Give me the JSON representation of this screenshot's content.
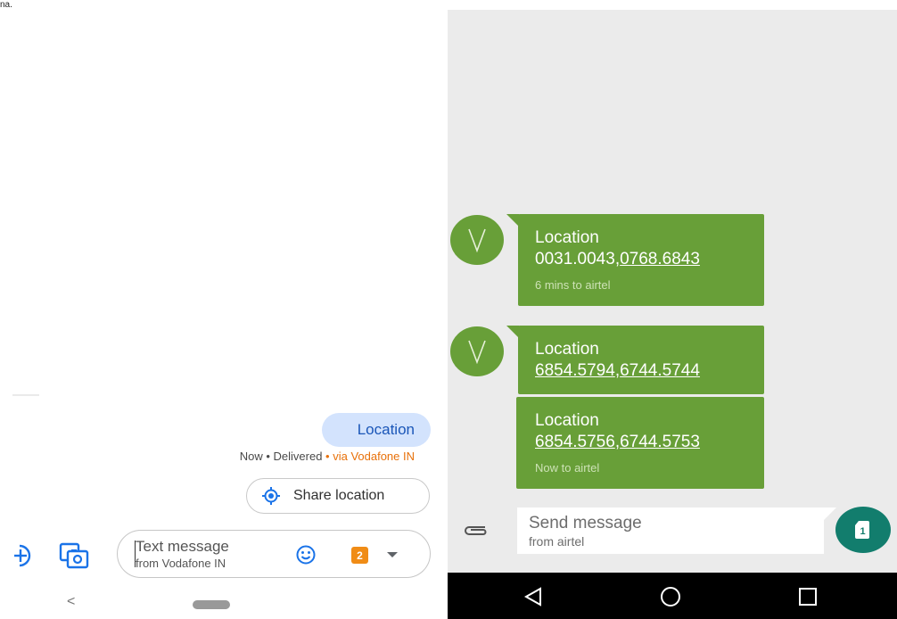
{
  "left": {
    "corner_text": "na.",
    "sent_message": "Location",
    "status": {
      "prefix": "Now • Delivered",
      "via": " • via Vodafone IN"
    },
    "share_location_label": "Share location",
    "compose": {
      "placeholder_line1": "Text message",
      "placeholder_line2": "from Vodafone IN",
      "sim_number": "2"
    },
    "nav": {
      "back_glyph": "<"
    },
    "icons": [
      "add-icon",
      "gallery-icon",
      "location-target-icon",
      "emoji-icon",
      "sim-icon",
      "dropdown-arrow-icon"
    ]
  },
  "right": {
    "messages": [
      {
        "title": "Location",
        "coords_a": "0031.0043",
        "separator": ",",
        "coords_b": "0768.6843",
        "meta": "6 mins to airtel"
      },
      {
        "title": "Location",
        "coords_a": "6854.5794",
        "separator": ",",
        "coords_b": "6744.5744",
        "meta": ""
      },
      {
        "title": "Location",
        "coords_a": "6854.5756",
        "separator": ",",
        "coords_b": "6744.5753",
        "meta": "Now to airtel"
      }
    ],
    "compose": {
      "placeholder_line1": "Send message",
      "placeholder_line2": "from airtel",
      "sim_number": "1"
    },
    "colors": {
      "bubble": "#689f38",
      "send_button": "#127d6d",
      "navbar": "#000000"
    },
    "icons": [
      "avatar-v-icon",
      "attach-icon",
      "sim-send-icon",
      "back-triangle-icon",
      "home-circle-icon",
      "recents-square-icon"
    ]
  }
}
